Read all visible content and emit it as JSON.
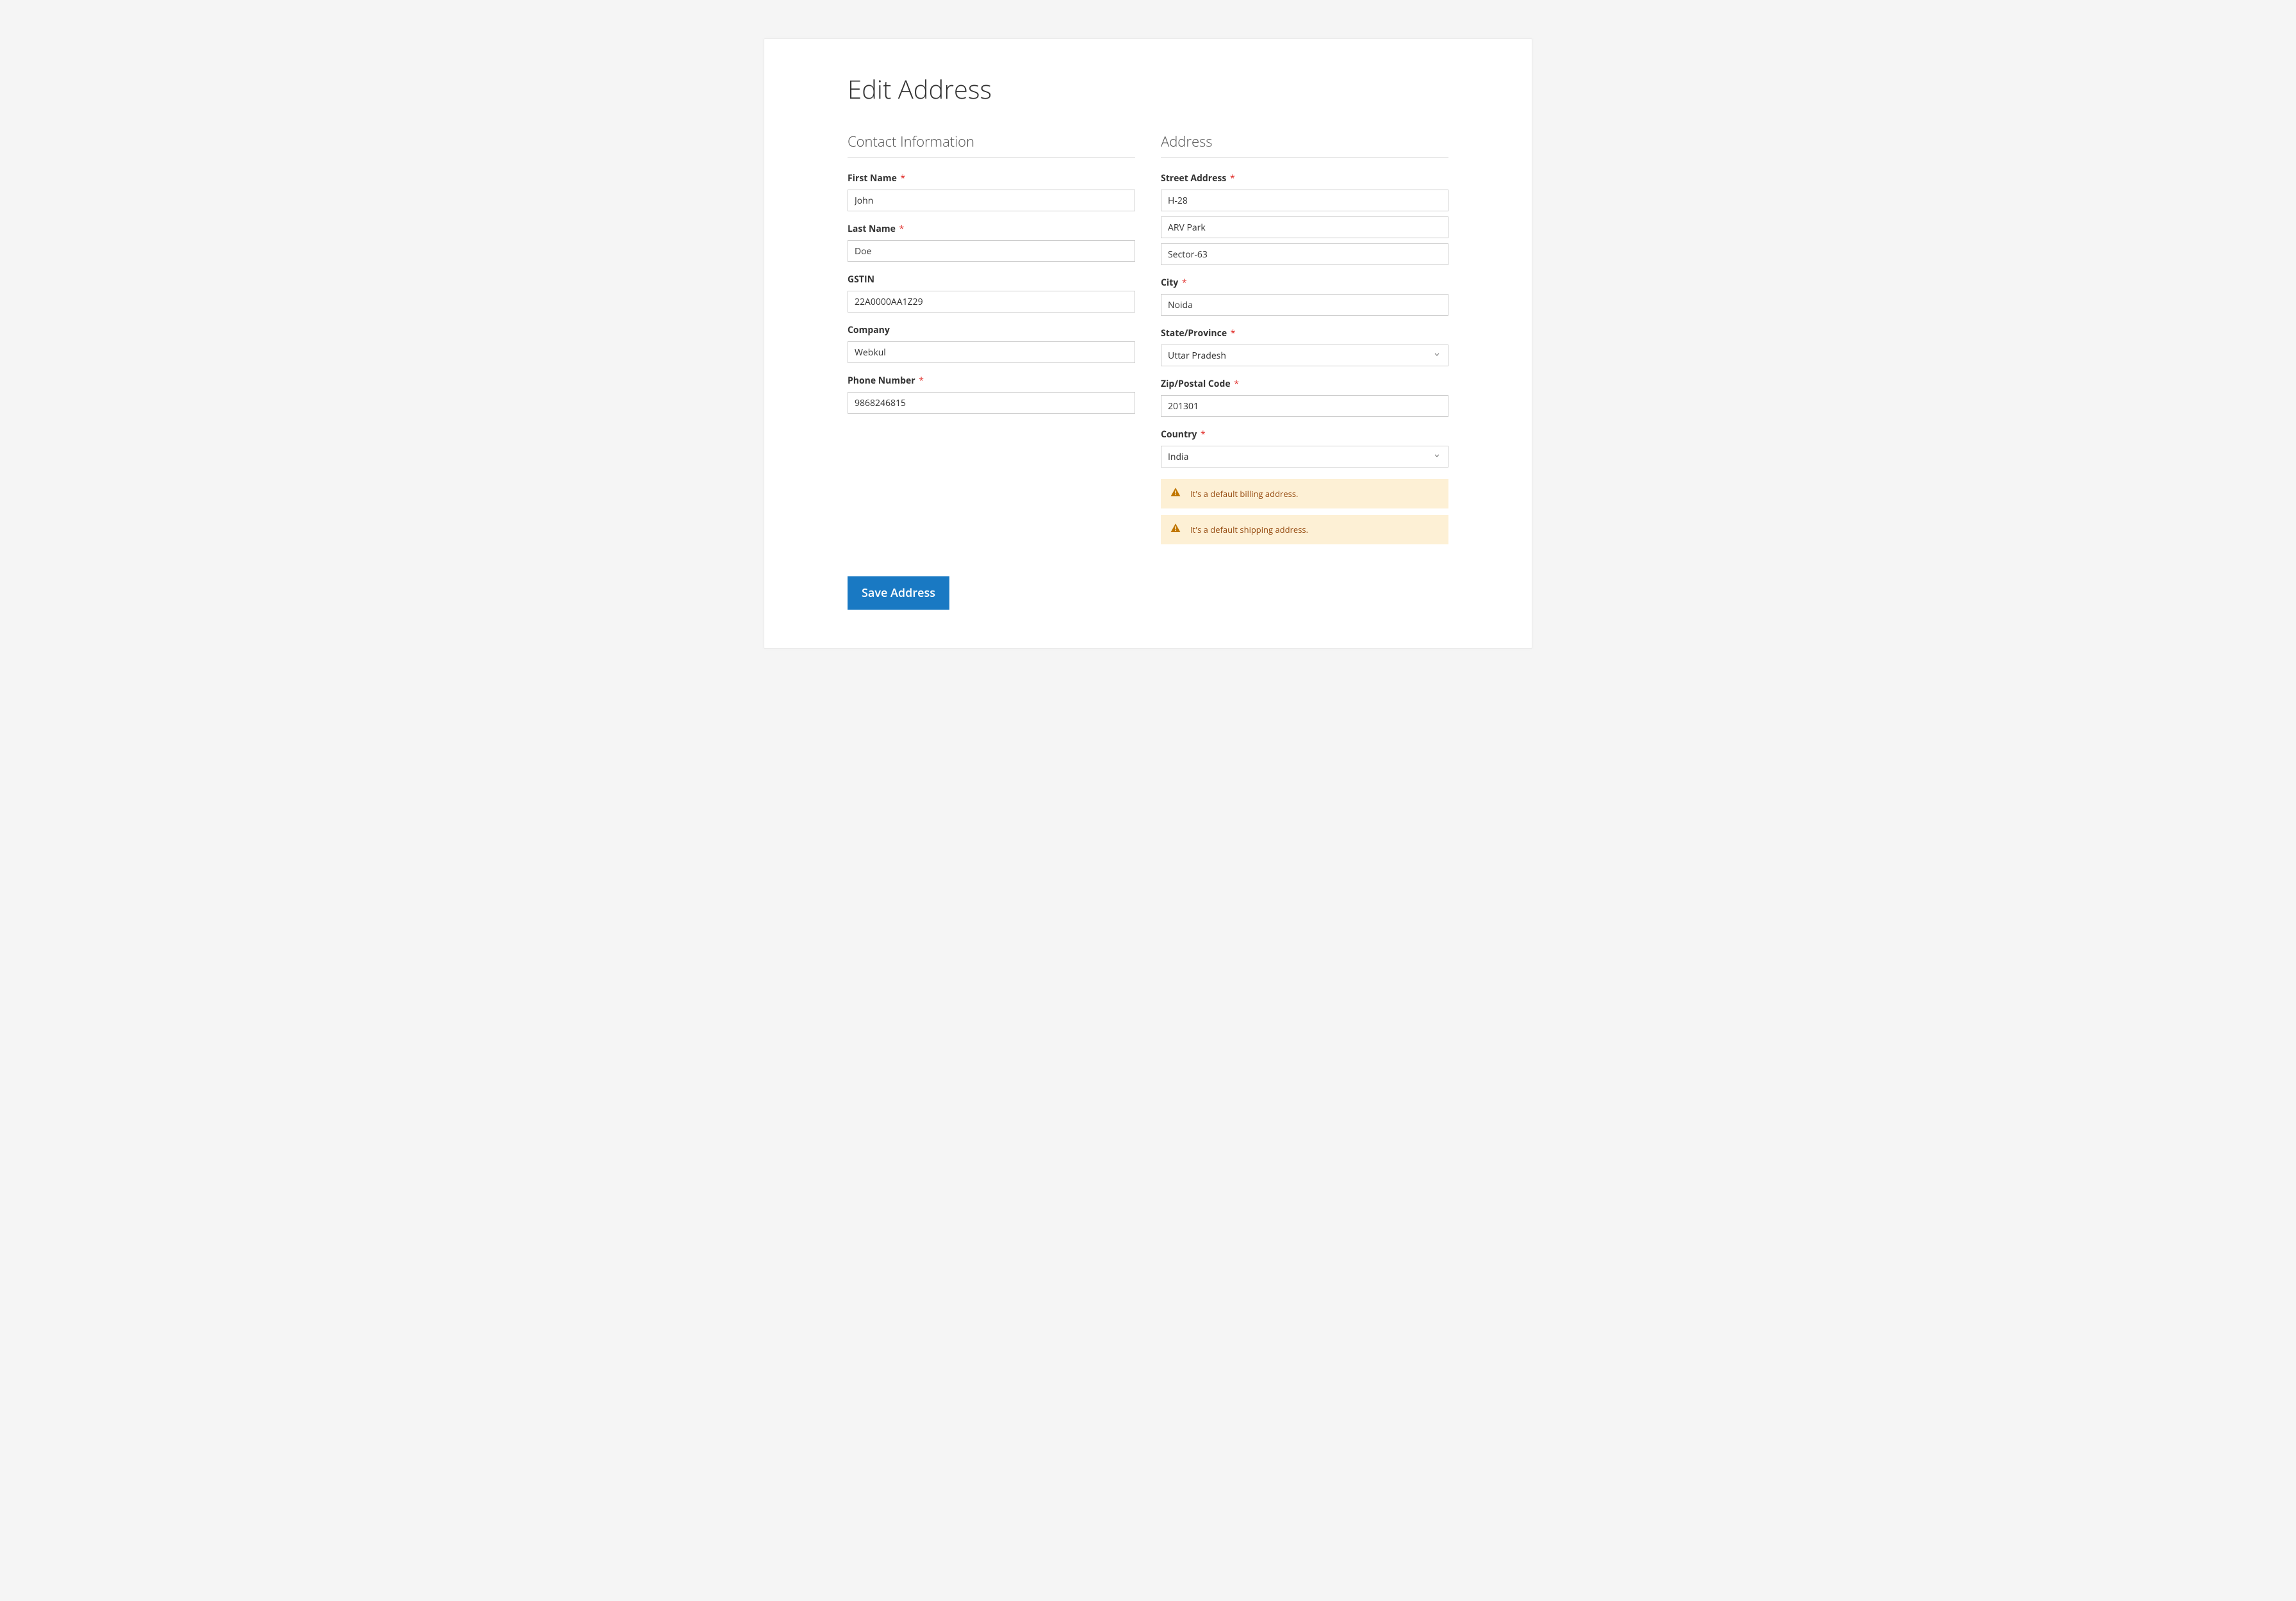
{
  "page": {
    "title": "Edit Address"
  },
  "contact": {
    "legend": "Contact Information",
    "first_name": {
      "label": "First Name",
      "value": "John",
      "required": true
    },
    "last_name": {
      "label": "Last Name",
      "value": "Doe",
      "required": true
    },
    "gstin": {
      "label": "GSTIN",
      "value": "22A0000AA1Z29",
      "required": false
    },
    "company": {
      "label": "Company",
      "value": "Webkul",
      "required": false
    },
    "phone": {
      "label": "Phone Number",
      "value": "9868246815",
      "required": true
    }
  },
  "address": {
    "legend": "Address",
    "street": {
      "label": "Street Address",
      "required": true,
      "lines": [
        "H-28",
        "ARV Park",
        "Sector-63"
      ]
    },
    "city": {
      "label": "City",
      "value": "Noida",
      "required": true
    },
    "state": {
      "label": "State/Province",
      "value": "Uttar Pradesh",
      "required": true
    },
    "zip": {
      "label": "Zip/Postal Code",
      "value": "201301",
      "required": true
    },
    "country": {
      "label": "Country",
      "value": "India",
      "required": true
    },
    "notices": {
      "billing": "It's a default billing address.",
      "shipping": "It's a default shipping address."
    }
  },
  "actions": {
    "save_label": "Save Address"
  },
  "glyphs": {
    "required": "*"
  }
}
